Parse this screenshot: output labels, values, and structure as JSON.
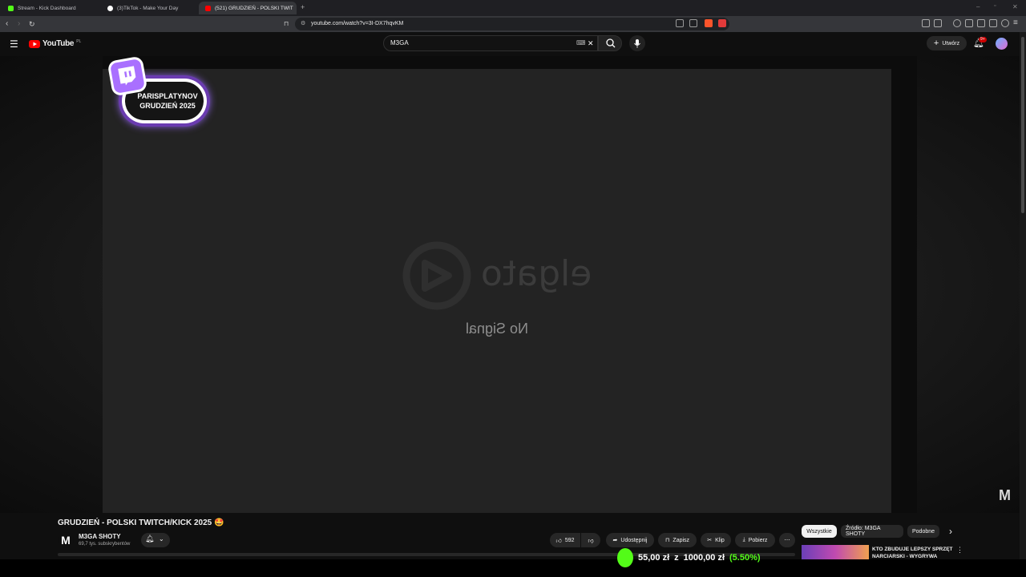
{
  "browser": {
    "tabs": [
      {
        "label": "Stream - Kick Dashboard",
        "favicon_color": "#53fc18"
      },
      {
        "label": "(3)TikTok - Make Your Day",
        "favicon_color": "#ffffff"
      },
      {
        "label": "(521) GRUDZIEŃ - POLSKI TWIT",
        "favicon_color": "#ff0000"
      }
    ],
    "url": "youtube.com/watch?v=3I-DX7hqvKM"
  },
  "youtube": {
    "logo_text": "YouTube",
    "region": "PL",
    "search_value": "M3GA",
    "create_label": "Utwórz",
    "notifications_badge": "9+"
  },
  "video": {
    "overlay_line1": "PARISPLATYNOV",
    "overlay_line2": "GRUDZIEŃ 2025",
    "elgato_text": "elgato",
    "no_signal_text": "No Signal",
    "watermark": "M",
    "title": "GRUDZIEŃ - POLSKI TWITCH/KICK 2025 🤩"
  },
  "channel": {
    "logo_letter": "M",
    "name": "M3GA SHOTY",
    "subscribers": "69,7 tys. subskrybentów"
  },
  "actions": {
    "likes": "592",
    "share": "Udostępnij",
    "save": "Zapisz",
    "clip": "Klip",
    "download": "Pobierz"
  },
  "chips": [
    "Wszystkie",
    "Źródło: M3GA SHOTY",
    "Podobne"
  ],
  "recommendation": {
    "title": "KTO ZBUDUJE LEPSZY SPRZĘT NARCIARSKI - WYGRYWA"
  },
  "donation": {
    "current": "55,00 zł",
    "separator": "z",
    "goal": "1000,00 zł",
    "percent": "(5.50%)",
    "fraction": 0.055
  },
  "colors": {
    "accent_kick": "#53fc18",
    "youtube_red": "#ff0000",
    "twitch_purple": "#a970ff"
  }
}
